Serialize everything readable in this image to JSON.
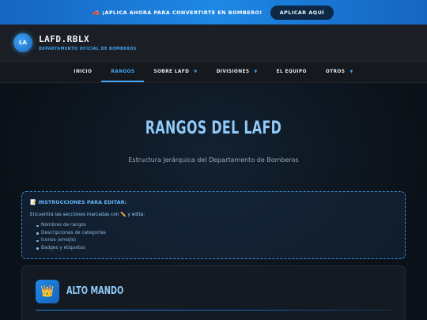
{
  "banner": {
    "icon": "fire-truck-icon",
    "text": "🚒 ¡APLICA AHORA PARA CONVERTIRTE EN BOMBERO!",
    "cta_label": "APLICAR AQUÍ"
  },
  "header": {
    "logo_text": "LA",
    "brand_name": "LAFD.RBLX",
    "brand_subtitle": "DEPARTAMENTO OFICIAL DE BOMBEROS"
  },
  "nav": {
    "items": [
      {
        "label": "INICIO",
        "dropdown": false
      },
      {
        "label": "RANGOS",
        "dropdown": false,
        "active": true
      },
      {
        "label": "SOBRE LAFD",
        "dropdown": true
      },
      {
        "label": "DIVISIONES",
        "dropdown": true
      },
      {
        "label": "EL EQUIPO",
        "dropdown": false
      },
      {
        "label": "OTROS",
        "dropdown": true
      }
    ],
    "caret": "▼"
  },
  "hero": {
    "title": "RANGOS DEL LAFD",
    "subtitle": "Estructura Jerárquica del Departamento de Bomberos"
  },
  "instructions": {
    "title": "📝 INSTRUCCIONES PARA EDITAR:",
    "text": "Encuentra las secciones marcadas con ✏️ y edita:",
    "items": [
      "Nombres de rangos",
      "Descripciones de categorías",
      "Iconos (emojis)",
      "Badges y etiquetas"
    ]
  },
  "section": {
    "icon": "crown-icon",
    "icon_glyph": "👑",
    "title": "ALTO MANDO"
  },
  "colors": {
    "accent": "#42a5f5",
    "banner": "#1e88e5",
    "background": "#0b1118"
  }
}
